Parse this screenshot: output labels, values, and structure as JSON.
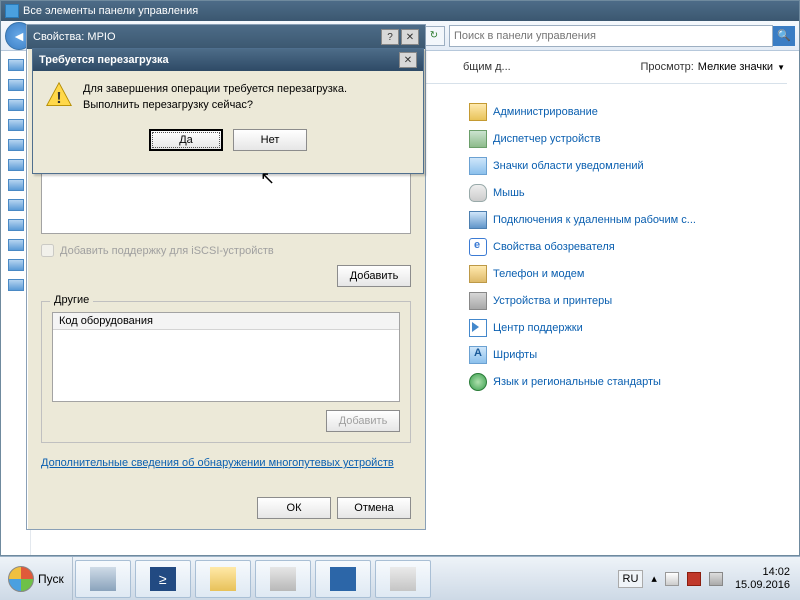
{
  "explorer": {
    "title": "Все элементы панели управления",
    "search_placeholder": "Поиск в панели управления",
    "truncated_item": "бщим д...",
    "view_label": "Просмотр:",
    "view_value": "Мелкие значки",
    "items": [
      "Администрирование",
      "Диспетчер устройств",
      "Значки области уведомлений",
      "Мышь",
      "Подключения к удаленным рабочим с...",
      "Свойства обозревателя",
      "Телефон и модем",
      "Устройства и принтеры",
      "Центр поддержки",
      "Шрифты",
      "Язык и региональные стандарты"
    ]
  },
  "mpio": {
    "title": "Свойства: MPIO",
    "chk_label": "Добавить поддержку для iSCSI-устройств",
    "add_btn": "Добавить",
    "group_title": "Другие",
    "hw_code_header": "Код оборудования",
    "add_btn2": "Добавить",
    "link": "Дополнительные сведения об обнаружении многопутевых устройств",
    "ok_btn": "ОК",
    "cancel_btn": "Отмена"
  },
  "confirm": {
    "title": "Требуется перезагрузка",
    "line1": "Для завершения операции требуется перезагрузка.",
    "line2": "Выполнить перезагрузку сейчас?",
    "yes": "Да",
    "no": "Нет"
  },
  "taskbar": {
    "start": "Пуск",
    "lang": "RU",
    "time": "14:02",
    "date": "15.09.2016"
  }
}
